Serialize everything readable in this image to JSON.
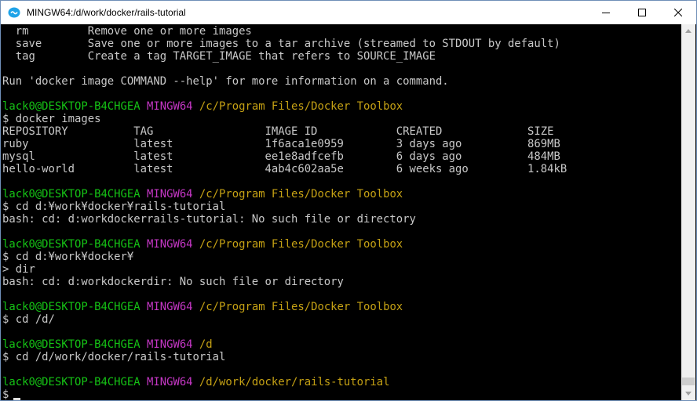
{
  "window": {
    "title": "MINGW64:/d/work/docker/rails-tutorial",
    "icon": "mintty-icon"
  },
  "terminal": {
    "lines": [
      [
        {
          "text": "  rm         Remove one or more images",
          "color": "default"
        }
      ],
      [
        {
          "text": "  save       Save one or more images to a tar archive (streamed to STDOUT by default)",
          "color": "default"
        }
      ],
      [
        {
          "text": "  tag        Create a tag TARGET_IMAGE that refers to SOURCE_IMAGE",
          "color": "default"
        }
      ],
      [
        {
          "text": "",
          "color": "default"
        }
      ],
      [
        {
          "text": "Run 'docker image COMMAND --help' for more information on a command.",
          "color": "default"
        }
      ],
      [
        {
          "text": "",
          "color": "default"
        }
      ],
      [
        {
          "text": "lack0@DESKTOP-B4CHGEA",
          "color": "green"
        },
        {
          "text": " ",
          "color": "default"
        },
        {
          "text": "MINGW64",
          "color": "magenta"
        },
        {
          "text": " ",
          "color": "default"
        },
        {
          "text": "/c/Program Files/Docker Toolbox",
          "color": "yellow"
        }
      ],
      [
        {
          "text": "$ docker images",
          "color": "default"
        }
      ],
      [
        {
          "text": "REPOSITORY          TAG                 IMAGE ID            CREATED             SIZE",
          "color": "default"
        }
      ],
      [
        {
          "text": "ruby                latest              1f6aca1e0959        3 days ago          869MB",
          "color": "default"
        }
      ],
      [
        {
          "text": "mysql               latest              ee1e8adfcefb        6 days ago          484MB",
          "color": "default"
        }
      ],
      [
        {
          "text": "hello-world         latest              4ab4c602aa5e        6 weeks ago         1.84kB",
          "color": "default"
        }
      ],
      [
        {
          "text": "",
          "color": "default"
        }
      ],
      [
        {
          "text": "lack0@DESKTOP-B4CHGEA",
          "color": "green"
        },
        {
          "text": " ",
          "color": "default"
        },
        {
          "text": "MINGW64",
          "color": "magenta"
        },
        {
          "text": " ",
          "color": "default"
        },
        {
          "text": "/c/Program Files/Docker Toolbox",
          "color": "yellow"
        }
      ],
      [
        {
          "text": "$ cd d:¥work¥docker¥rails-tutorial",
          "color": "default"
        }
      ],
      [
        {
          "text": "bash: cd: d:workdockerrails-tutorial: No such file or directory",
          "color": "default"
        }
      ],
      [
        {
          "text": "",
          "color": "default"
        }
      ],
      [
        {
          "text": "lack0@DESKTOP-B4CHGEA",
          "color": "green"
        },
        {
          "text": " ",
          "color": "default"
        },
        {
          "text": "MINGW64",
          "color": "magenta"
        },
        {
          "text": " ",
          "color": "default"
        },
        {
          "text": "/c/Program Files/Docker Toolbox",
          "color": "yellow"
        }
      ],
      [
        {
          "text": "$ cd d:¥work¥docker¥",
          "color": "default"
        }
      ],
      [
        {
          "text": "> dir",
          "color": "default"
        }
      ],
      [
        {
          "text": "bash: cd: d:workdockerdir: No such file or directory",
          "color": "default"
        }
      ],
      [
        {
          "text": "",
          "color": "default"
        }
      ],
      [
        {
          "text": "lack0@DESKTOP-B4CHGEA",
          "color": "green"
        },
        {
          "text": " ",
          "color": "default"
        },
        {
          "text": "MINGW64",
          "color": "magenta"
        },
        {
          "text": " ",
          "color": "default"
        },
        {
          "text": "/c/Program Files/Docker Toolbox",
          "color": "yellow"
        }
      ],
      [
        {
          "text": "$ cd /d/",
          "color": "default"
        }
      ],
      [
        {
          "text": "",
          "color": "default"
        }
      ],
      [
        {
          "text": "lack0@DESKTOP-B4CHGEA",
          "color": "green"
        },
        {
          "text": " ",
          "color": "default"
        },
        {
          "text": "MINGW64",
          "color": "magenta"
        },
        {
          "text": " ",
          "color": "default"
        },
        {
          "text": "/d",
          "color": "yellow"
        }
      ],
      [
        {
          "text": "$ cd /d/work/docker/rails-tutorial",
          "color": "default"
        }
      ],
      [
        {
          "text": "",
          "color": "default"
        }
      ],
      [
        {
          "text": "lack0@DESKTOP-B4CHGEA",
          "color": "green"
        },
        {
          "text": " ",
          "color": "default"
        },
        {
          "text": "MINGW64",
          "color": "magenta"
        },
        {
          "text": " ",
          "color": "default"
        },
        {
          "text": "/d/work/docker/rails-tutorial",
          "color": "yellow"
        }
      ],
      [
        {
          "text": "$",
          "color": "default"
        }
      ]
    ],
    "colors": {
      "background": "#000000",
      "default": "#c8c8c8",
      "green": "#15c315",
      "magenta": "#c537c5",
      "yellow": "#c5a114"
    }
  }
}
